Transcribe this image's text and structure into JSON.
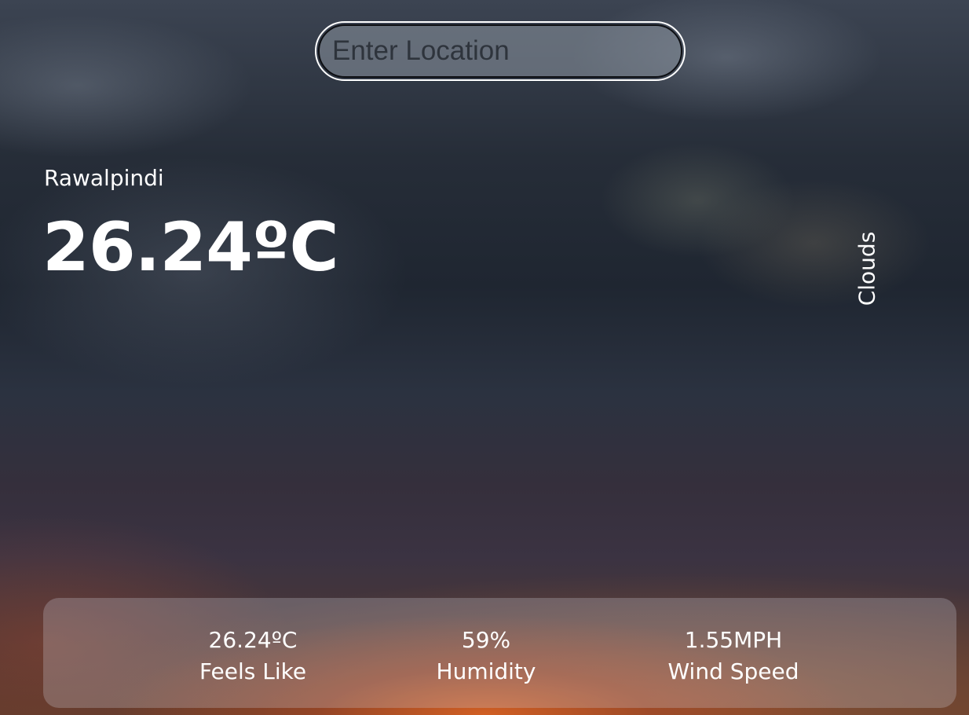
{
  "search": {
    "placeholder": "Enter Location",
    "value": ""
  },
  "current": {
    "city": "Rawalpindi",
    "temperature": "26.24ºC",
    "condition": "Clouds"
  },
  "stats": {
    "feels_like": {
      "value": "26.24ºC",
      "label": "Feels Like"
    },
    "humidity": {
      "value": "59%",
      "label": "Humidity"
    },
    "wind_speed": {
      "value": "1.55MPH",
      "label": "Wind Speed"
    }
  },
  "colors": {
    "text": "#ffffff",
    "sky_top": "#3c4452",
    "sunset": "#d66022",
    "panel": "#cdcdd7"
  }
}
